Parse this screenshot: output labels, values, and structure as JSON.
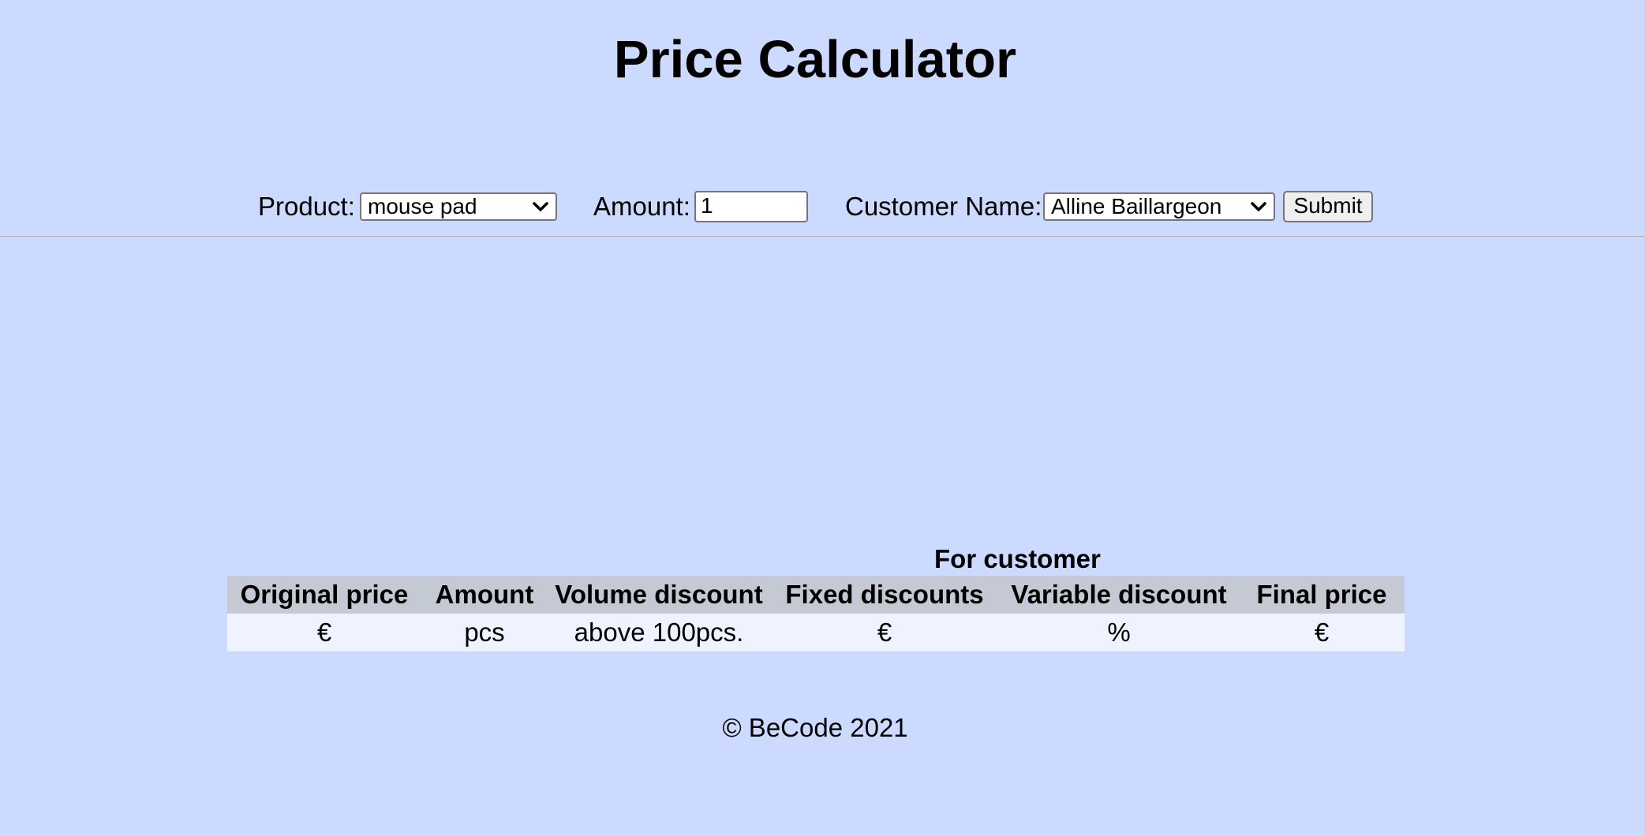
{
  "page": {
    "title": "Price Calculator",
    "footer": "© BeCode 2021"
  },
  "form": {
    "product_label": "Product:",
    "product_selected": "mouse pad",
    "amount_label": "Amount:",
    "amount_value": "1",
    "customer_label": "Customer Name:",
    "customer_selected": "Alline Baillargeon",
    "submit_label": "Submit"
  },
  "table": {
    "caption": "For customer",
    "headers": [
      "Original price",
      "Amount",
      "Volume discount",
      "Fixed discounts",
      "Variable discount",
      "Final price"
    ],
    "row": [
      "€",
      "pcs",
      "above 100pcs.",
      "€",
      "%",
      "€"
    ]
  },
  "colors": {
    "background": "#ccdaff",
    "header_row": "#c5c9d4",
    "body_row": "#eef3ff"
  },
  "icons": {
    "select_arrow": "chevron-down-icon"
  }
}
